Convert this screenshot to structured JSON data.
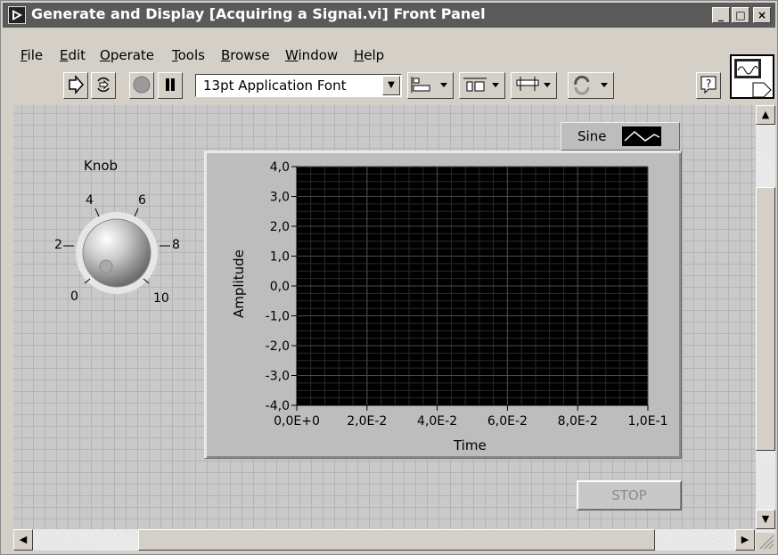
{
  "window": {
    "title": "Generate and Display [Acquiring a Signai.vi] Front Panel",
    "buttons": [
      "_",
      "□",
      "×"
    ]
  },
  "menu": [
    "File",
    "Edit",
    "Operate",
    "Tools",
    "Browse",
    "Window",
    "Help"
  ],
  "toolbar": {
    "font": "13pt Application Font",
    "buttons": [
      "run-arrow-icon",
      "run-continuous-icon",
      "abort-icon",
      "pause-icon",
      "align-icon",
      "distribute-icon",
      "resize-icon",
      "reorder-icon",
      "help-icon"
    ]
  },
  "knob": {
    "label": "Knob",
    "scale": [
      "0",
      "2",
      "4",
      "6",
      "8",
      "10"
    ],
    "value": 0
  },
  "graph": {
    "legend": "Sine",
    "ylabel": "Amplitude",
    "xlabel": "Time",
    "yticks": [
      "4,0",
      "3,0",
      "2,0",
      "1,0",
      "0,0",
      "-1,0",
      "-2,0",
      "-3,0",
      "-4,0"
    ],
    "xticks": [
      "0,0E+0",
      "2,0E-2",
      "4,0E-2",
      "6,0E-2",
      "8,0E-2",
      "1,0E-1"
    ],
    "plot_background": "#000000"
  },
  "stop_button": {
    "label": "STOP"
  }
}
